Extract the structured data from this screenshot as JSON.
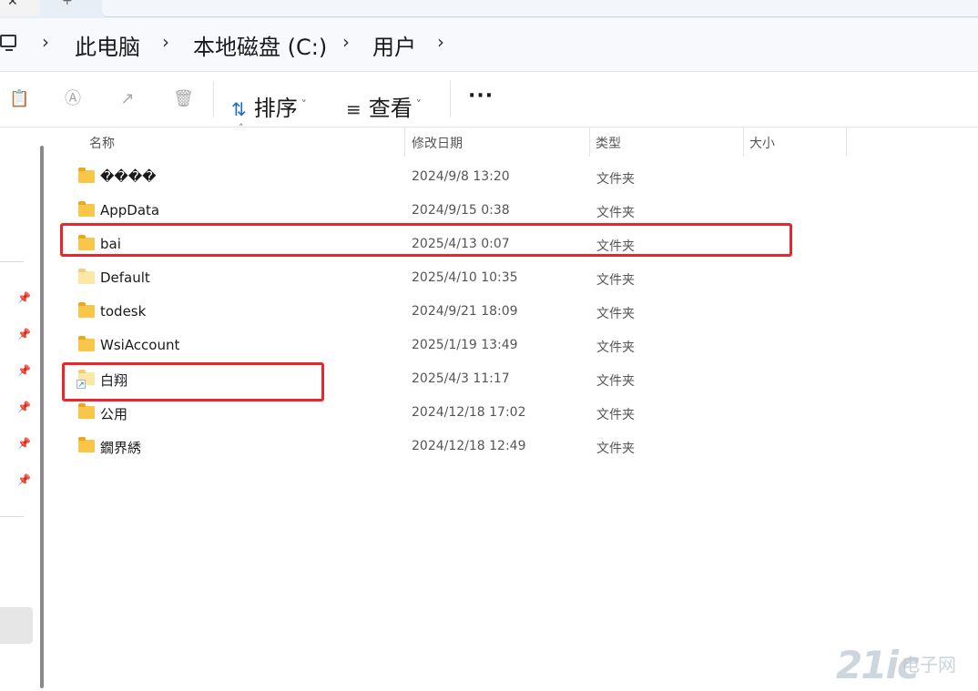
{
  "tabs": {
    "close_glyph": "✕",
    "new_glyph": "+"
  },
  "breadcrumb": {
    "items": [
      "此电脑",
      "本地磁盘 (C:)",
      "用户"
    ]
  },
  "toolbar": {
    "sort_label": "排序",
    "view_label": "查看",
    "more_label": "···"
  },
  "columns": {
    "name": "名称",
    "date": "修改日期",
    "type": "类型",
    "size": "大小"
  },
  "files": [
    {
      "name": "����",
      "date": "2024/9/8 13:20",
      "type": "文件夹",
      "icon": "folder-icon"
    },
    {
      "name": "AppData",
      "date": "2024/9/15 0:38",
      "type": "文件夹",
      "icon": "folder-icon"
    },
    {
      "name": "bai",
      "date": "2025/4/13 0:07",
      "type": "文件夹",
      "icon": "folder-icon"
    },
    {
      "name": "Default",
      "date": "2025/4/10 10:35",
      "type": "文件夹",
      "icon": "folder-light-icon"
    },
    {
      "name": "todesk",
      "date": "2024/9/21 18:09",
      "type": "文件夹",
      "icon": "folder-icon"
    },
    {
      "name": "WsiAccount",
      "date": "2025/1/19 13:49",
      "type": "文件夹",
      "icon": "folder-icon"
    },
    {
      "name": "白翔",
      "date": "2025/4/3 11:17",
      "type": "文件夹",
      "icon": "folder-shortcut-icon"
    },
    {
      "name": "公用",
      "date": "2024/12/18 17:02",
      "type": "文件夹",
      "icon": "folder-icon"
    },
    {
      "name": "鐗界綉",
      "date": "2024/12/18 12:49",
      "type": "文件夹",
      "icon": "folder-icon"
    }
  ],
  "watermark": {
    "logo": "21ic",
    "text": "电子网"
  },
  "colors": {
    "highlight": "#e8262b",
    "folder": "#f8c74a",
    "accent": "#1f6fc5"
  }
}
